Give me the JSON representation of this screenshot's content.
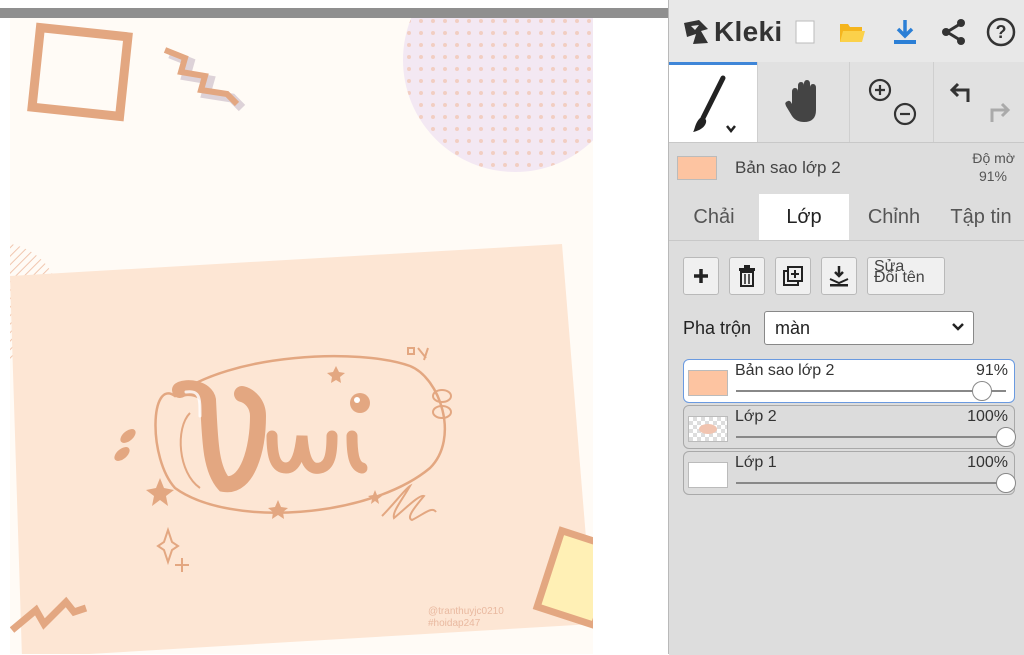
{
  "app": {
    "name": "Kleki"
  },
  "toolbar": {
    "new_icon": "new-file-icon",
    "open_icon": "folder-icon",
    "save_icon": "download-icon",
    "share_icon": "share-icon",
    "help_icon": "help-icon"
  },
  "tools": {
    "brush": "brush-icon",
    "hand": "hand-icon",
    "zoom": "zoom-icon",
    "undo": "undo-icon"
  },
  "current_layer": {
    "name": "Bản sao lớp 2",
    "opacity_label": "Độ mờ",
    "opacity_value": "91%"
  },
  "tabs": [
    {
      "label": "Chải",
      "active": false
    },
    {
      "label": "Lớp",
      "active": true
    },
    {
      "label": "Chỉnh",
      "active": false
    },
    {
      "label": "Tập tin",
      "active": false
    }
  ],
  "layer_actions": {
    "rename_a": "Sửa",
    "rename_b": "Đổi tên"
  },
  "blend": {
    "label": "Pha trộn",
    "value": "màn"
  },
  "layers": [
    {
      "name": "Bản sao lớp 2",
      "opacity": "91%",
      "level": 0.91,
      "active": true
    },
    {
      "name": "Lớp 2",
      "opacity": "100%",
      "level": 1.0,
      "active": false
    },
    {
      "name": "Lớp 1",
      "opacity": "100%",
      "level": 1.0,
      "active": false
    }
  ],
  "canvas": {
    "watermark_line1": "@tranthuyjc0210",
    "watermark_line2": "#hoidap247",
    "colors": {
      "bg": "#fffbf6",
      "peach": "#fde6d4",
      "accent": "#e2a67f",
      "lavender": "#f1e6f2"
    }
  }
}
